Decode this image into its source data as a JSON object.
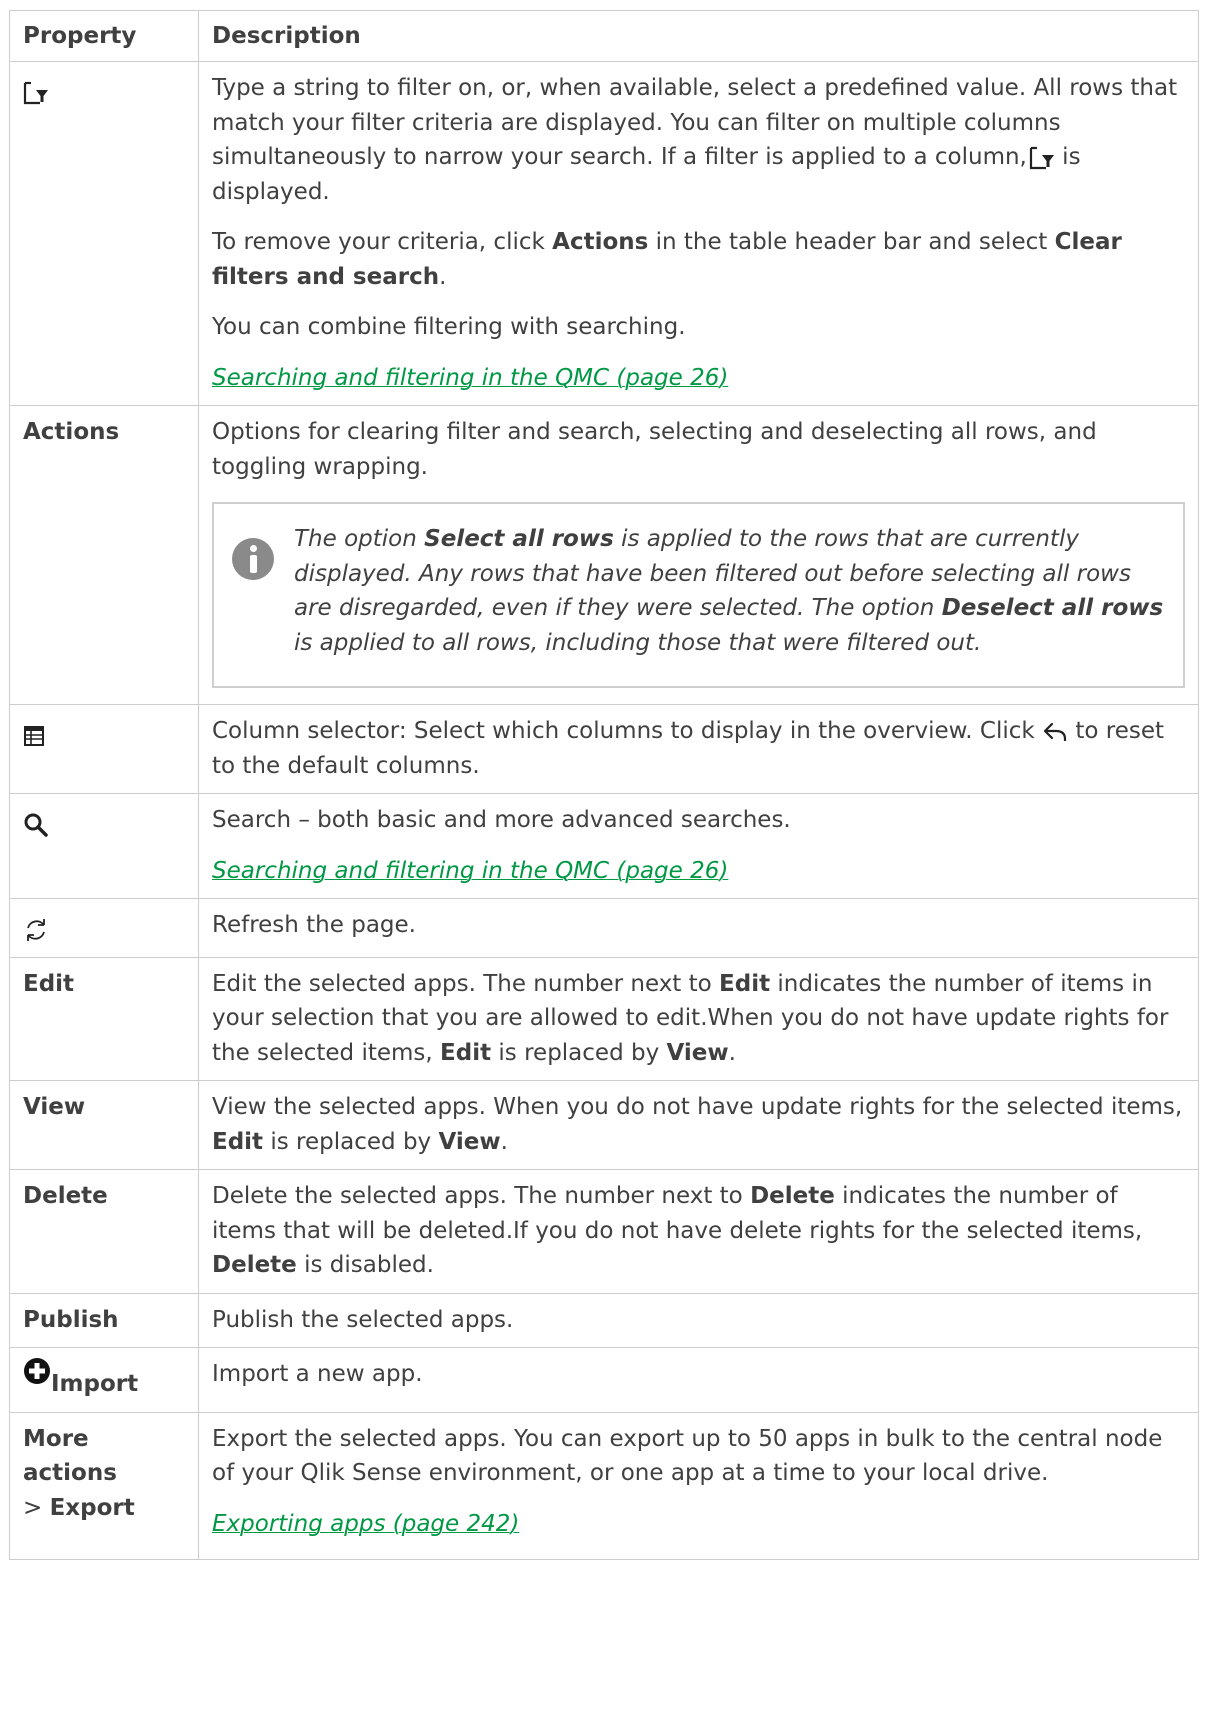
{
  "headers": {
    "property": "Property",
    "description": "Description"
  },
  "filter_row": {
    "icon": "filter-icon",
    "p1_a": "Type a string to filter on, or, when available, select a predefined value. All rows that match your filter criteria are displayed. You can filter on multiple columns simultaneously to narrow your search. If a filter is applied to a column,",
    "p1_b": " is displayed.",
    "p2_a": "To remove your criteria, click ",
    "p2_b1": "Actions",
    "p2_c": " in the table header bar and select ",
    "p2_b2": "Clear filters and search",
    "p2_d": ".",
    "p3": "You can combine filtering with searching.",
    "link": " Searching and filtering in the QMC (page 26)"
  },
  "actions_row": {
    "label": "Actions",
    "desc": "Options for clearing filter and search, selecting and deselecting all rows, and toggling wrapping.",
    "note_a": "The option ",
    "note_b1": "Select all rows",
    "note_c": " is applied to the rows that are currently displayed. Any rows that have been filtered out before selecting all rows are disregarded, even if they were selected. The option ",
    "note_b2": "Deselect all rows",
    "note_d": " is applied to all rows, including those that were filtered out."
  },
  "column_row": {
    "icon": "column-selector-icon",
    "desc_a": "Column selector: Select which columns to display in the overview. Click ",
    "desc_b": " to reset to the default columns.",
    "inline_icon": "undo-arrow-icon"
  },
  "search_row": {
    "icon": "search-icon",
    "desc": "Search – both basic and more advanced searches.",
    "link": " Searching and filtering in the QMC (page 26)"
  },
  "refresh_row": {
    "icon": "refresh-icon",
    "desc": "Refresh the page."
  },
  "edit_row": {
    "label": "Edit",
    "a": "Edit the selected apps. The number next to ",
    "b1": "Edit",
    "c": " indicates the number of items in your selection that you are allowed to edit.When you do not have update rights for the selected items, ",
    "b2": "Edit",
    "d": " is replaced by ",
    "b3": "View",
    "e": "."
  },
  "view_row": {
    "label": "View",
    "a": "View the selected apps. When you do not have update rights for the selected items, ",
    "b1": "Edit",
    "c": " is replaced by ",
    "b2": "View",
    "d": "."
  },
  "delete_row": {
    "label": "Delete",
    "a": "Delete the selected apps. The number next to ",
    "b1": "Delete",
    "c": " indicates the number of items that will be deleted.If you do not have delete rights for the selected items, ",
    "b2": "Delete",
    "d": " is disabled."
  },
  "publish_row": {
    "label": "Publish",
    "desc": "Publish the selected apps."
  },
  "import_row": {
    "icon": "plus-circle-icon",
    "label": "Import",
    "desc": "Import a new app."
  },
  "more_row": {
    "label_a": "More actions",
    "label_sep": "> ",
    "label_b": "Export",
    "desc": "Export the selected apps. You can export up to 50 apps in bulk to the central node of your Qlik Sense environment, or one app at a time to your local drive.",
    "link": "Exporting apps (page 242)"
  }
}
